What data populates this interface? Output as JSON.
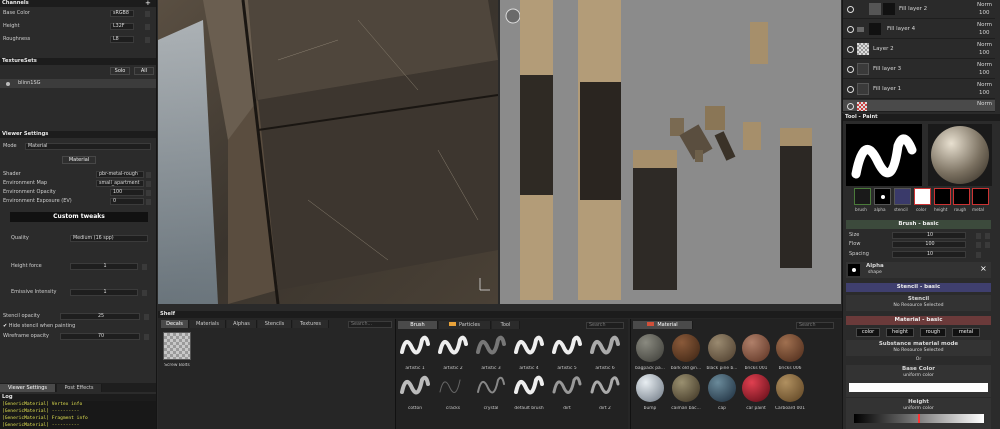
{
  "channels": {
    "title": "Channels",
    "rows": [
      {
        "name": "Base Color",
        "format": "sRGB8"
      },
      {
        "name": "Height",
        "format": "L32F"
      },
      {
        "name": "Roughness",
        "format": "L8"
      }
    ]
  },
  "texturesets": {
    "title": "TextureSets",
    "solo": "Solo",
    "all": "All",
    "item": "blinn1SG"
  },
  "viewer": {
    "title": "Viewer Settings",
    "mode_label": "Mode",
    "mode_value": "Material",
    "material_btn": "Material",
    "shader_label": "Shader",
    "shader_value": "pbr-metal-rough",
    "env_map_label": "Environment Map",
    "env_map_value": "small_apartment",
    "env_opacity_label": "Environment Opacity",
    "env_opacity_value": "100",
    "env_exposure_label": "Environment Exposure (EV)",
    "env_exposure_value": "0",
    "custom_tweaks": "Custom tweaks",
    "quality_label": "Quality",
    "quality_value": "Medium (16 spp)",
    "height_force_label": "Height force",
    "height_force_value": "1",
    "emissive_label": "Emissive Intensity",
    "emissive_value": "1",
    "stencil_opacity_label": "Stencil opacity",
    "stencil_opacity_value": "25",
    "hide_stencil_label": "Hide stencil when painting",
    "wireframe_label": "Wireframe opacity",
    "wireframe_value": "70"
  },
  "bottom_tabs": {
    "viewer": "Viewer Settings",
    "post": "Post Effects"
  },
  "log": {
    "title": "Log",
    "lines": [
      "[GenericMaterial] Vertex info",
      "[GenericMaterial] ----------",
      "[GenericMaterial] Fragment info",
      "[GenericMaterial] ----------"
    ]
  },
  "shelf": {
    "title": "Shelf",
    "tabs": [
      "Decals",
      "Materials",
      "Alphas",
      "Stencils",
      "Textures"
    ],
    "search": "Search...",
    "decal_item": "Screw Bolts",
    "brush_tabs": [
      "Brush",
      "Particles",
      "Tool"
    ],
    "brush_search": "Search",
    "brushes": [
      "artistic 1",
      "artistic 2",
      "artistic 3",
      "artistic 4",
      "artistic 5",
      "artistic 6",
      "cotton",
      "cracks",
      "crystal",
      "default brush",
      "dirt",
      "dirt 2"
    ],
    "material_tab": "Material",
    "material_search": "Search",
    "materials": [
      "bagpack pa...",
      "bark old gin...",
      "black pine b...",
      "bricks 001",
      "bricks 006",
      "bump",
      "caiman bac...",
      "cap",
      "car paint",
      "Carboard 001"
    ]
  },
  "layers": [
    {
      "name": "Fill layer 2",
      "blend": "Norm",
      "opacity": "100"
    },
    {
      "name": "Fill layer 4",
      "blend": "Norm",
      "opacity": "100"
    },
    {
      "name": "Layer 2",
      "blend": "Norm",
      "opacity": "100"
    },
    {
      "name": "Fill layer 3",
      "blend": "Norm",
      "opacity": "100"
    },
    {
      "name": "Fill layer 1",
      "blend": "Norm",
      "opacity": "100"
    },
    {
      "name": "",
      "blend": "Norm",
      "opacity": ""
    }
  ],
  "tool": {
    "title": "Tool - Paint",
    "channels": [
      "brush",
      "alpha",
      "stencil",
      "color",
      "height",
      "rough",
      "metal"
    ],
    "brush_section": "Brush - basic",
    "size_label": "Size",
    "size_value": "10",
    "flow_label": "Flow",
    "flow_value": "100",
    "spacing_label": "Spacing",
    "spacing_value": "10",
    "alpha_label": "Alpha",
    "alpha_sub": "shape",
    "stencil_section": "Stencil - basic",
    "stencil_btn": "Stencil",
    "stencil_none": "No Resource Selected",
    "material_section": "Material - basic",
    "mat_channels": [
      "color",
      "height",
      "rough",
      "metal"
    ],
    "substance_mode": "Substance material mode",
    "substance_none": "No Resource Selected",
    "or": "Or",
    "base_color_label": "Base Color",
    "base_color_sub": "uniform color",
    "height_label": "Height",
    "height_sub": "uniform color"
  },
  "colors": {
    "stencil_section": "#3f3f6e",
    "material_section": "#6b3a3a",
    "brush_section": "#3c4a3c"
  }
}
